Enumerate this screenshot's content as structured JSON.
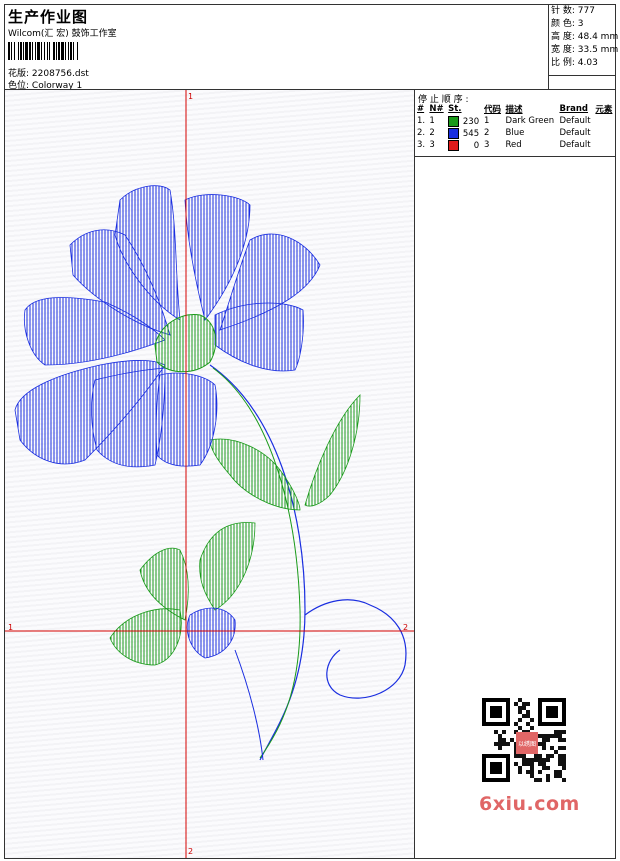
{
  "header": {
    "title": "生产作业图",
    "company": "Wilcom(汇 宏) 鼓饰工作室",
    "design_label": "花版:",
    "design_value": "2208756.dst",
    "colorway_label": "色位:",
    "colorway_value": "Colorway 1"
  },
  "stats": [
    {
      "label": "针 数:",
      "value": "777"
    },
    {
      "label": "颜 色:",
      "value": "3"
    },
    {
      "label": "高 度:",
      "value": "48.4 mm"
    },
    {
      "label": "宽 度:",
      "value": "33.5 mm"
    },
    {
      "label": "比 例:",
      "value": "4.03"
    }
  ],
  "stop_sequence": {
    "title": "停 止 顺 序 :",
    "columns": [
      "#",
      "N#",
      "St.",
      "代码",
      "描述",
      "Brand",
      "元素"
    ],
    "rows": [
      {
        "idx": "1.",
        "n": "1",
        "color": "#1a9a1a",
        "st": "230",
        "code": "1",
        "desc": "Dark Green",
        "brand": "Default"
      },
      {
        "idx": "2.",
        "n": "2",
        "color": "#1a2ee0",
        "st": "545",
        "code": "2",
        "desc": "Blue",
        "brand": "Default"
      },
      {
        "idx": "3.",
        "n": "3",
        "color": "#e01a1a",
        "st": "0",
        "code": "3",
        "desc": "Red",
        "brand": "Default"
      }
    ]
  },
  "axis_labels": {
    "top": "1",
    "bottom": "2",
    "left": "1",
    "right": "2"
  },
  "watermark": "6xiu.com",
  "qr_badge": "以绣图",
  "colors": {
    "green": "#1a9a1a",
    "blue": "#1a2ee0",
    "red": "#e01a1a",
    "axis": "#d40000"
  }
}
